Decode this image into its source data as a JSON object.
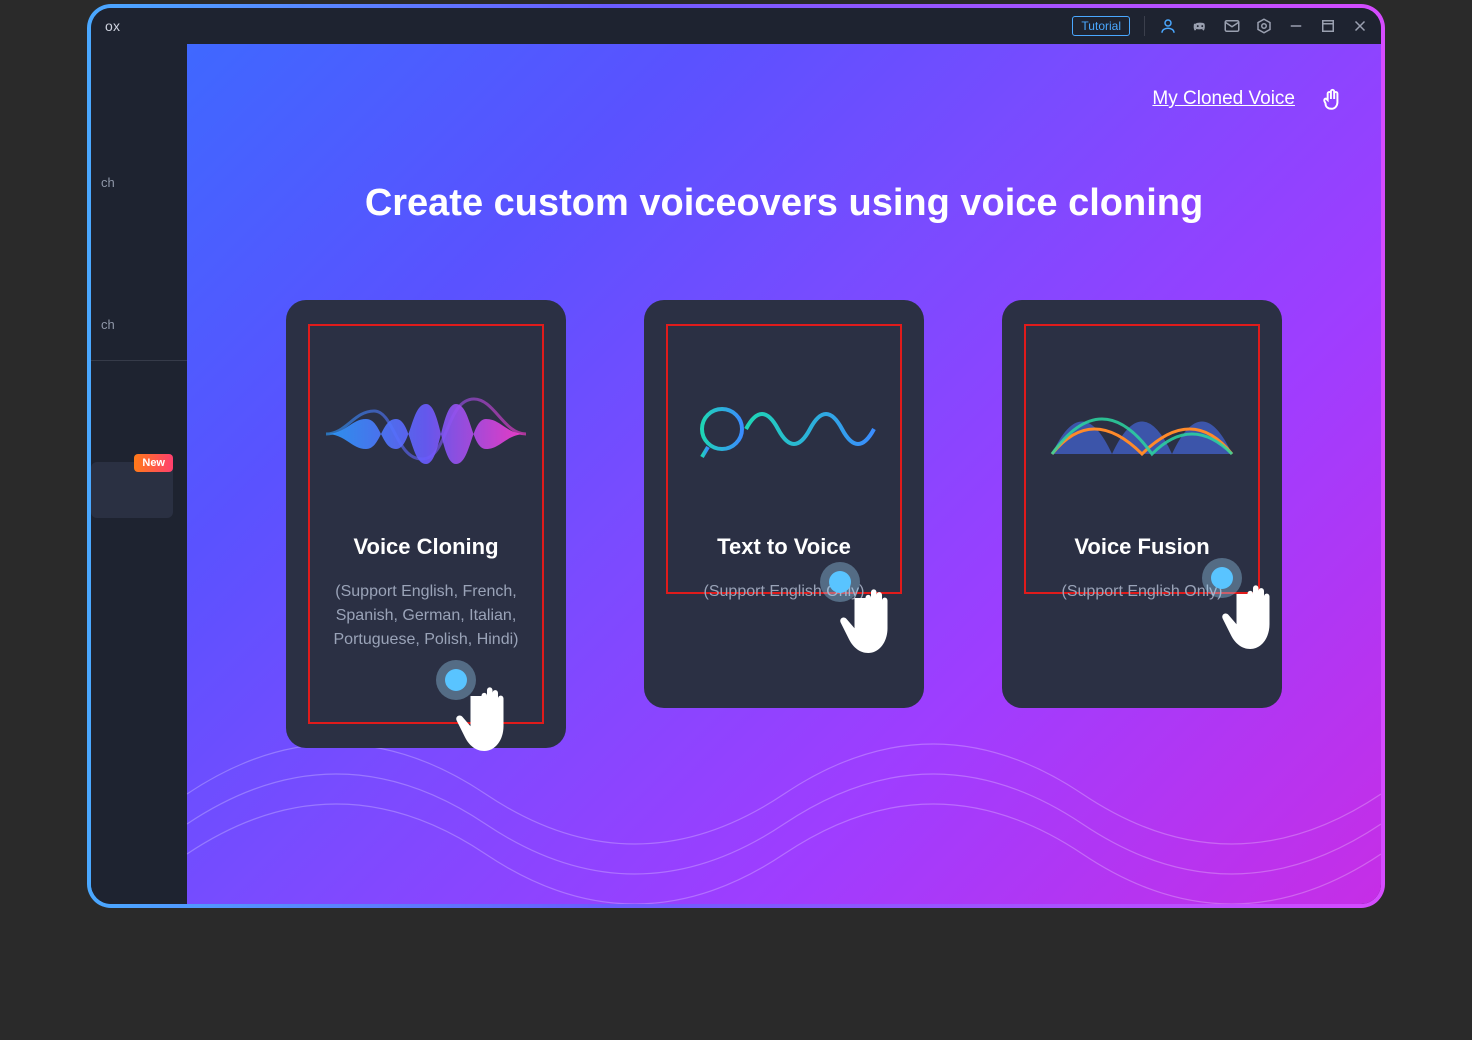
{
  "titlebar": {
    "app_abbrev": "ox",
    "tutorial_label": "Tutorial"
  },
  "sidebar": {
    "item1_label": "ch",
    "item2_label": "ch",
    "new_badge": "New"
  },
  "main": {
    "my_cloned_link": "My Cloned Voice",
    "heading": "Create custom voiceovers using voice cloning",
    "cards": [
      {
        "title": "Voice Cloning",
        "subtitle": "(Support English, French, Spanish, German, Italian, Portuguese, Polish, Hindi)"
      },
      {
        "title": "Text to Voice",
        "subtitle": "(Support English Only)"
      },
      {
        "title": "Voice Fusion",
        "subtitle": "(Support English Only)"
      }
    ]
  }
}
